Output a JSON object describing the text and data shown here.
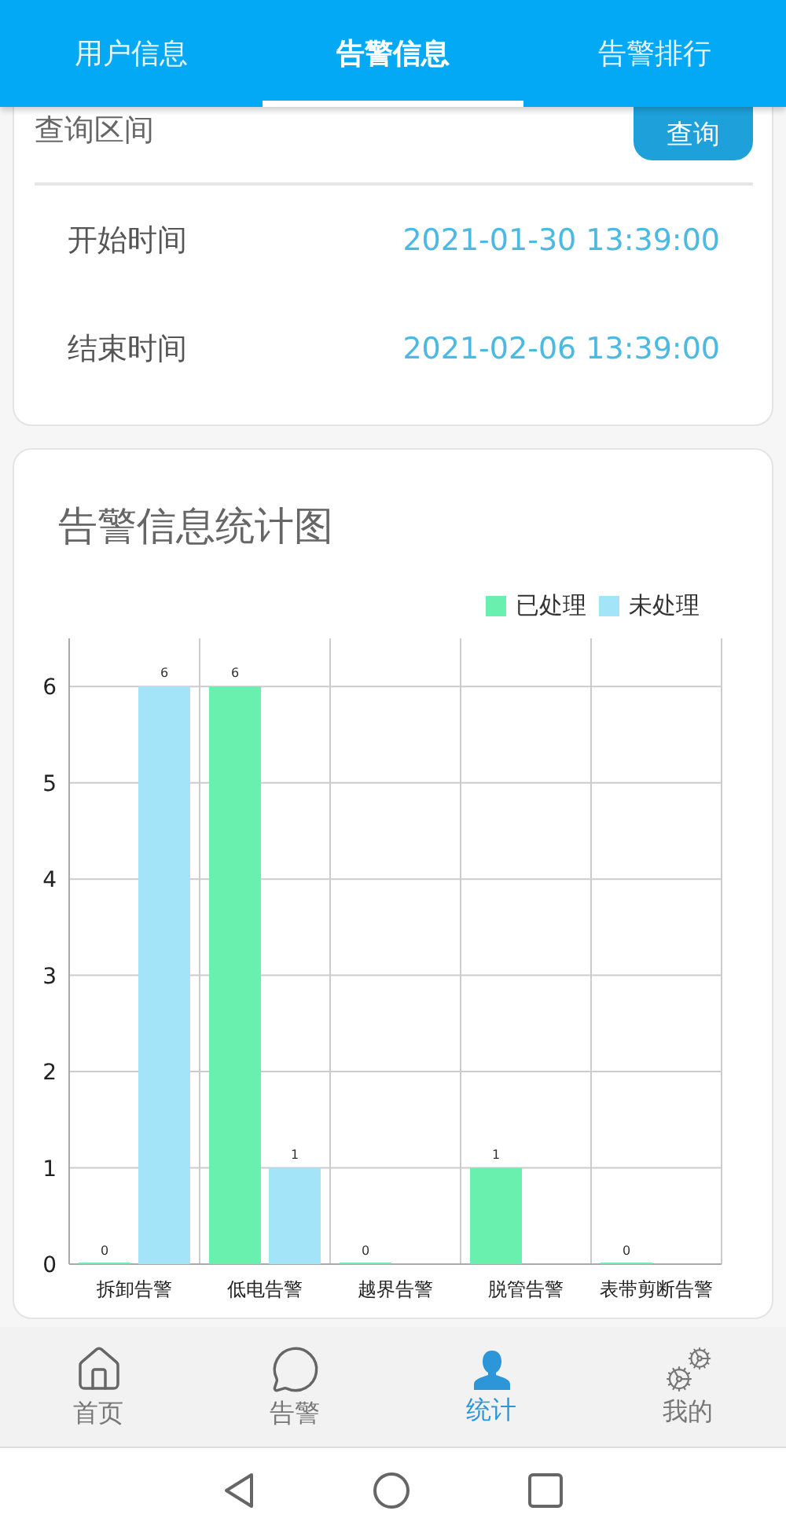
{
  "tabs": [
    {
      "label": "用户信息",
      "selected": false
    },
    {
      "label": "告警信息",
      "selected": true
    },
    {
      "label": "告警排行",
      "selected": false
    }
  ],
  "query_card": {
    "title": "查询区间",
    "button": "查询",
    "rows": [
      {
        "label": "开始时间",
        "value": "2021-01-30 13:39:00"
      },
      {
        "label": "结束时间",
        "value": "2021-02-06 13:39:00"
      }
    ]
  },
  "chart_card": {
    "title": "告警信息统计图",
    "chart_data": {
      "type": "bar",
      "categories": [
        "拆卸告警",
        "低电告警",
        "越界告警",
        "脱管告警",
        "表带剪断告警"
      ],
      "series": [
        {
          "name": "已处理",
          "color": "#69f0ae",
          "values": [
            0,
            6,
            0,
            1,
            0
          ]
        },
        {
          "name": "未处理",
          "color": "#a3e4f9",
          "values": [
            6,
            1,
            null,
            null,
            null
          ]
        }
      ],
      "ylim": [
        0,
        6.5
      ],
      "yticks": [
        0,
        1,
        2,
        3,
        4,
        5,
        6
      ],
      "data_labels": true,
      "grid": true
    }
  },
  "bottom_nav": [
    {
      "kind": "home",
      "label": "首页",
      "selected": false
    },
    {
      "kind": "chat",
      "label": "告警",
      "selected": false
    },
    {
      "kind": "person",
      "label": "统计",
      "selected": true
    },
    {
      "kind": "gears",
      "label": "我的",
      "selected": false
    }
  ]
}
